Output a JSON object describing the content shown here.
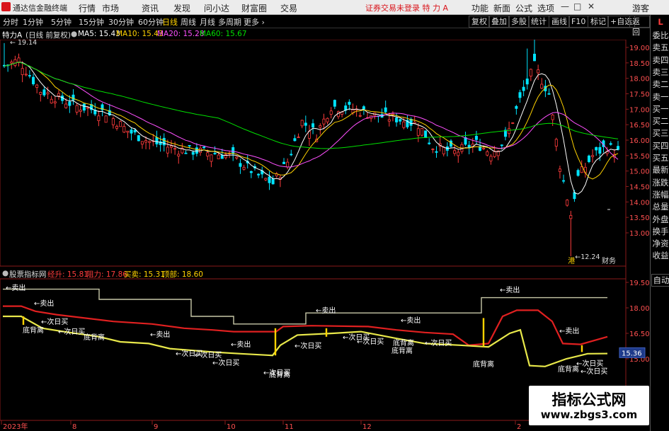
{
  "titlebar": {
    "app_name": "通达信金融终端",
    "menus": [
      "行情",
      "市场",
      "资讯",
      "发现",
      "问小达",
      "财富圈",
      "交易"
    ],
    "notice": "证券交易未登录  特 力 A",
    "right_menus": [
      "功能",
      "新面",
      "公式",
      "选项"
    ],
    "user": "游客",
    "win_controls": [
      "—",
      "□",
      "✕"
    ]
  },
  "toolbar": {
    "periods": [
      "分时",
      "1分钟",
      "5分钟",
      "15分钟",
      "30分钟",
      "60分钟",
      "日线",
      "周线",
      "月线",
      "多周期",
      "更多 ›"
    ],
    "active_period": "日线",
    "right_tabs": [
      "复权",
      "叠加",
      "多股",
      "统计",
      "画线",
      "F10",
      "标记",
      "+自选",
      "返回"
    ]
  },
  "main_info": {
    "stock": "特力A",
    "mode": "(日线 前复权)",
    "ma5": "MA5: 15.43",
    "ma10": "MA10: 15.43",
    "ma20": "MA20: 15.28",
    "ma60": "MA60: 15.67"
  },
  "sidebar": {
    "badge": "L",
    "items": [
      "委比",
      "卖五",
      "卖四",
      "卖三",
      "卖二",
      "卖一",
      "买一",
      "买二",
      "买三",
      "买四",
      "买五",
      "最新",
      "涨跌",
      "涨幅",
      "总量",
      "外盘",
      "换手",
      "净资",
      "收益",
      "自动"
    ]
  },
  "price_axis": [
    "19.00",
    "18.50",
    "18.00",
    "17.50",
    "17.00",
    "16.50",
    "16.00",
    "15.50",
    "15.00",
    "14.50",
    "14.00",
    "13.50",
    "13.00"
  ],
  "annotations": {
    "high": "19.14",
    "low": "12.24",
    "low_tag": "港",
    "fin_tag": "财务"
  },
  "indicator": {
    "name": "股票指标网",
    "support": "经升: 15.81",
    "resist": "阻力: 17.86",
    "buysell": "买卖: 15.31",
    "top": "顶部: 18.60",
    "axis": [
      "19.50",
      "18.00",
      "16.50",
      "15.00"
    ],
    "current_tag": "15.36",
    "signals": {
      "sell": "←卖出",
      "buy_next": "←次日买",
      "bottom_div": "底背离"
    }
  },
  "time_axis": [
    "2023年",
    "8",
    "9",
    "10",
    "11",
    "12",
    "2"
  ],
  "watermark": {
    "title": "指标公式网",
    "url": "www.zbgs3.com"
  },
  "colors": {
    "up": "#ff3c3c",
    "down": "#00e4ff",
    "ma5": "#ffffff",
    "ma10": "#ffd200",
    "ma20": "#ff50ff",
    "ma60": "#00e000",
    "support_line": "#e8e84a",
    "resist_line": "#e02020",
    "top_line": "#c0c0a0"
  }
}
